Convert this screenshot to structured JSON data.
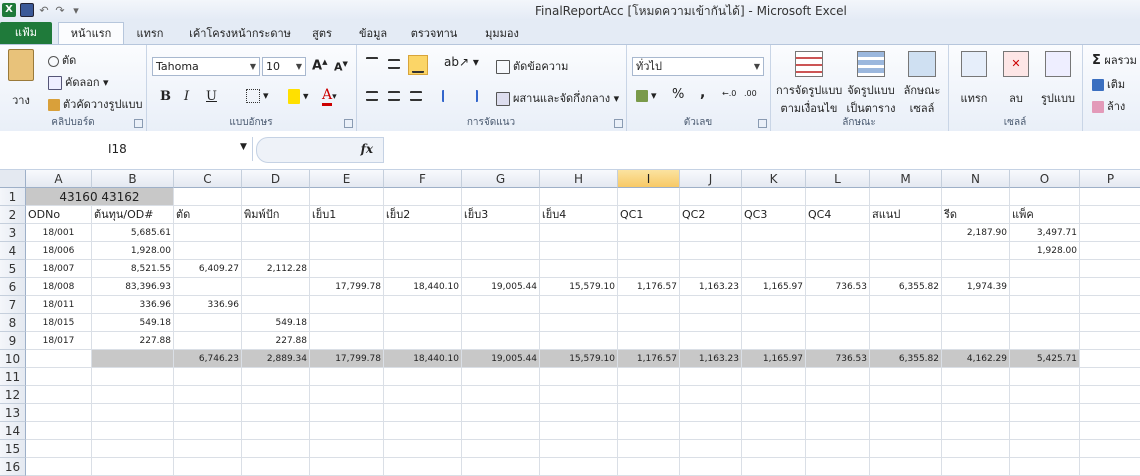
{
  "window": {
    "title": "FinalReportAcc  [โหมดความเข้ากันได้] - Microsoft Excel"
  },
  "qat": {
    "undo": "↶",
    "redo": "↷",
    "customize": "▾"
  },
  "tabs": [
    {
      "label": "แฟ้ม",
      "key": "file"
    },
    {
      "label": "หน้าแรก",
      "key": "home"
    },
    {
      "label": "แทรก",
      "key": "insert"
    },
    {
      "label": "เค้าโครงหน้ากระดาษ",
      "key": "layout"
    },
    {
      "label": "สูตร",
      "key": "formulas"
    },
    {
      "label": "ข้อมูล",
      "key": "data"
    },
    {
      "label": "ตรวจทาน",
      "key": "review"
    },
    {
      "label": "มุมมอง",
      "key": "view"
    }
  ],
  "ribbon": {
    "clipboard": {
      "label": "คลิปบอร์ด",
      "paste": "วาง",
      "cut": "ตัด",
      "copy": "คัดลอก",
      "format_painter": "ตัวคัดวางรูปแบบ"
    },
    "font": {
      "label": "แบบอักษร",
      "name": "Tahoma",
      "size": "10",
      "bold": "B",
      "italic": "I",
      "underline": "U"
    },
    "alignment": {
      "label": "การจัดแนว",
      "wrap": "ตัดข้อความ",
      "merge": "ผสานและจัดกึ่งกลาง"
    },
    "number": {
      "label": "ตัวเลข",
      "format": "ทั่วไป",
      "percent": "%",
      "comma": ","
    },
    "styles": {
      "label": "ลักษณะ",
      "conditional_1": "การจัดรูปแบบ",
      "conditional_2": "ตามเงื่อนไข",
      "table_1": "จัดรูปแบบ",
      "table_2": "เป็นตาราง",
      "cell_1": "ลักษณะ",
      "cell_2": "เซลล์"
    },
    "cells": {
      "label": "เซลล์",
      "insert": "แทรก",
      "delete": "ลบ",
      "format": "รูปแบบ"
    },
    "editing": {
      "sum": "ผลรวม",
      "fill": "เติม",
      "clear": "ล้าง"
    }
  },
  "formula_bar": {
    "name_box": "I18",
    "fx": "fx",
    "content": ""
  },
  "columns": [
    "A",
    "B",
    "C",
    "D",
    "E",
    "F",
    "G",
    "H",
    "I",
    "J",
    "K",
    "L",
    "M",
    "N",
    "O",
    "P"
  ],
  "selected_column": "I",
  "rows": [
    "1",
    "2",
    "3",
    "4",
    "5",
    "6",
    "7",
    "8",
    "9",
    "10",
    "11",
    "12",
    "13",
    "14",
    "15",
    "16"
  ],
  "sheet": {
    "row1": {
      "A": "43160",
      "B": "43162"
    },
    "headers": [
      "ODNo",
      "ต้นทุน/OD#",
      "ตัด",
      "พิมพ์ปัก",
      "เย็บ1",
      "เย็บ2",
      "เย็บ3",
      "เย็บ4",
      "QC1",
      "QC2",
      "QC3",
      "QC4",
      "สแนป",
      "รีด",
      "แพ็ค"
    ],
    "data": [
      [
        "18/001",
        "5,685.61",
        "",
        "",
        "",
        "",
        "",
        "",
        "",
        "",
        "",
        "",
        "",
        "2,187.90",
        "3,497.71"
      ],
      [
        "18/006",
        "1,928.00",
        "",
        "",
        "",
        "",
        "",
        "",
        "",
        "",
        "",
        "",
        "",
        "",
        "1,928.00"
      ],
      [
        "18/007",
        "8,521.55",
        "6,409.27",
        "2,112.28",
        "",
        "",
        "",
        "",
        "",
        "",
        "",
        "",
        "",
        "",
        ""
      ],
      [
        "18/008",
        "83,396.93",
        "",
        "",
        "17,799.78",
        "18,440.10",
        "19,005.44",
        "15,579.10",
        "1,176.57",
        "1,163.23",
        "1,165.97",
        "736.53",
        "6,355.82",
        "1,974.39",
        ""
      ],
      [
        "18/011",
        "336.96",
        "336.96",
        "",
        "",
        "",
        "",
        "",
        "",
        "",
        "",
        "",
        "",
        "",
        ""
      ],
      [
        "18/015",
        "549.18",
        "",
        "549.18",
        "",
        "",
        "",
        "",
        "",
        "",
        "",
        "",
        "",
        "",
        ""
      ],
      [
        "18/017",
        "227.88",
        "",
        "227.88",
        "",
        "",
        "",
        "",
        "",
        "",
        "",
        "",
        "",
        "",
        ""
      ]
    ],
    "totals": [
      "",
      "",
      "6,746.23",
      "2,889.34",
      "17,799.78",
      "18,440.10",
      "19,005.44",
      "15,579.10",
      "1,176.57",
      "1,163.23",
      "1,165.97",
      "736.53",
      "6,355.82",
      "4,162.29",
      "5,425.71"
    ]
  }
}
